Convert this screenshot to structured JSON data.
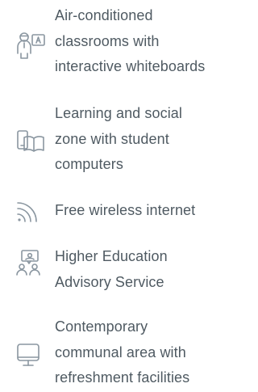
{
  "features": [
    {
      "icon": "classroom-teacher-icon",
      "lines": [
        "Air-conditioned",
        "classrooms with",
        "interactive whiteboards"
      ]
    },
    {
      "icon": "computer-tablet-icon",
      "lines": [
        "Learning and social",
        "zone with student",
        "computers"
      ]
    },
    {
      "icon": "wifi-icon",
      "lines": [
        "Free wireless internet"
      ]
    },
    {
      "icon": "advisory-people-icon",
      "lines": [
        "Higher Education",
        "Advisory Service"
      ]
    },
    {
      "icon": "monitor-icon",
      "lines": [
        "Contemporary",
        "communal area with",
        "refreshment facilities"
      ]
    }
  ],
  "colors": {
    "text": "#4f5a62",
    "icon": "#8a96a0"
  }
}
